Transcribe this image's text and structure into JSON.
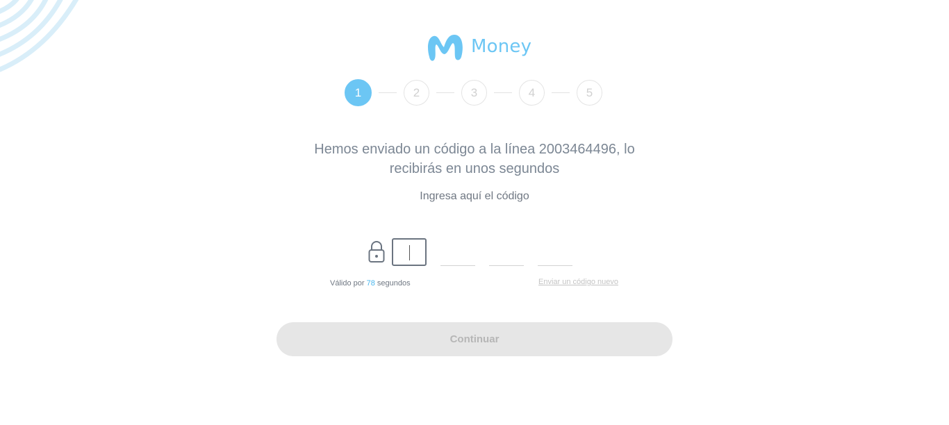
{
  "brand": {
    "logo_text": "Money",
    "accent_color": "#6cc6f4",
    "logo_icon": "movistar-m-icon"
  },
  "stepper": {
    "current_step": 1,
    "steps": [
      "1",
      "2",
      "3",
      "4",
      "5"
    ]
  },
  "message": {
    "headline_line1": "Hemos enviado un código a la línea 2003464496, lo",
    "headline_line2": "recibirás en unos segundos",
    "instruction": "Ingresa aquí el código"
  },
  "code_input": {
    "lock_icon": "lock-icon",
    "digits": [
      "",
      "",
      "",
      ""
    ]
  },
  "validity": {
    "prefix": "Válido por",
    "seconds": "78",
    "suffix": "segundos"
  },
  "resend": {
    "label": "Enviar un código nuevo"
  },
  "actions": {
    "continue_label": "Continuar"
  }
}
